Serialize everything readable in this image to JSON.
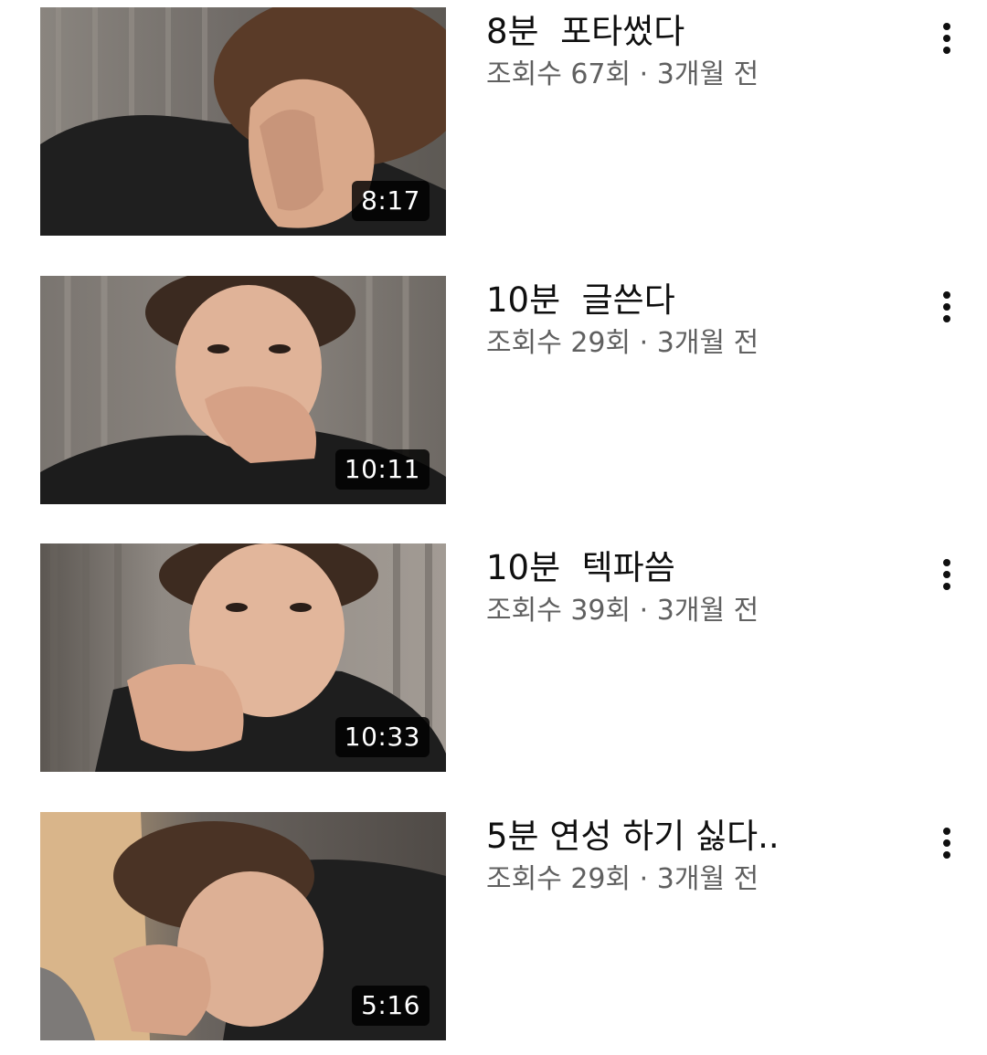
{
  "videos": [
    {
      "title": "8분  포타썼다",
      "views": "조회수 67회",
      "separator": "·",
      "age": "3개월 전",
      "duration": "8:17",
      "more_icon": "more-vert-icon"
    },
    {
      "title": "10분  글쓴다",
      "views": "조회수 29회",
      "separator": "·",
      "age": "3개월 전",
      "duration": "10:11",
      "more_icon": "more-vert-icon"
    },
    {
      "title": "10분  텍파씀",
      "views": "조회수 39회",
      "separator": "·",
      "age": "3개월 전",
      "duration": "10:33",
      "more_icon": "more-vert-icon"
    },
    {
      "title": "5분 연성 하기 싫다..",
      "views": "조회수 29회",
      "separator": "·",
      "age": "3개월 전",
      "duration": "5:16",
      "more_icon": "more-vert-icon"
    }
  ],
  "colors": {
    "title": "#0f0f0f",
    "meta": "#606060",
    "duration_bg": "#000000",
    "duration_text": "#ffffff"
  }
}
